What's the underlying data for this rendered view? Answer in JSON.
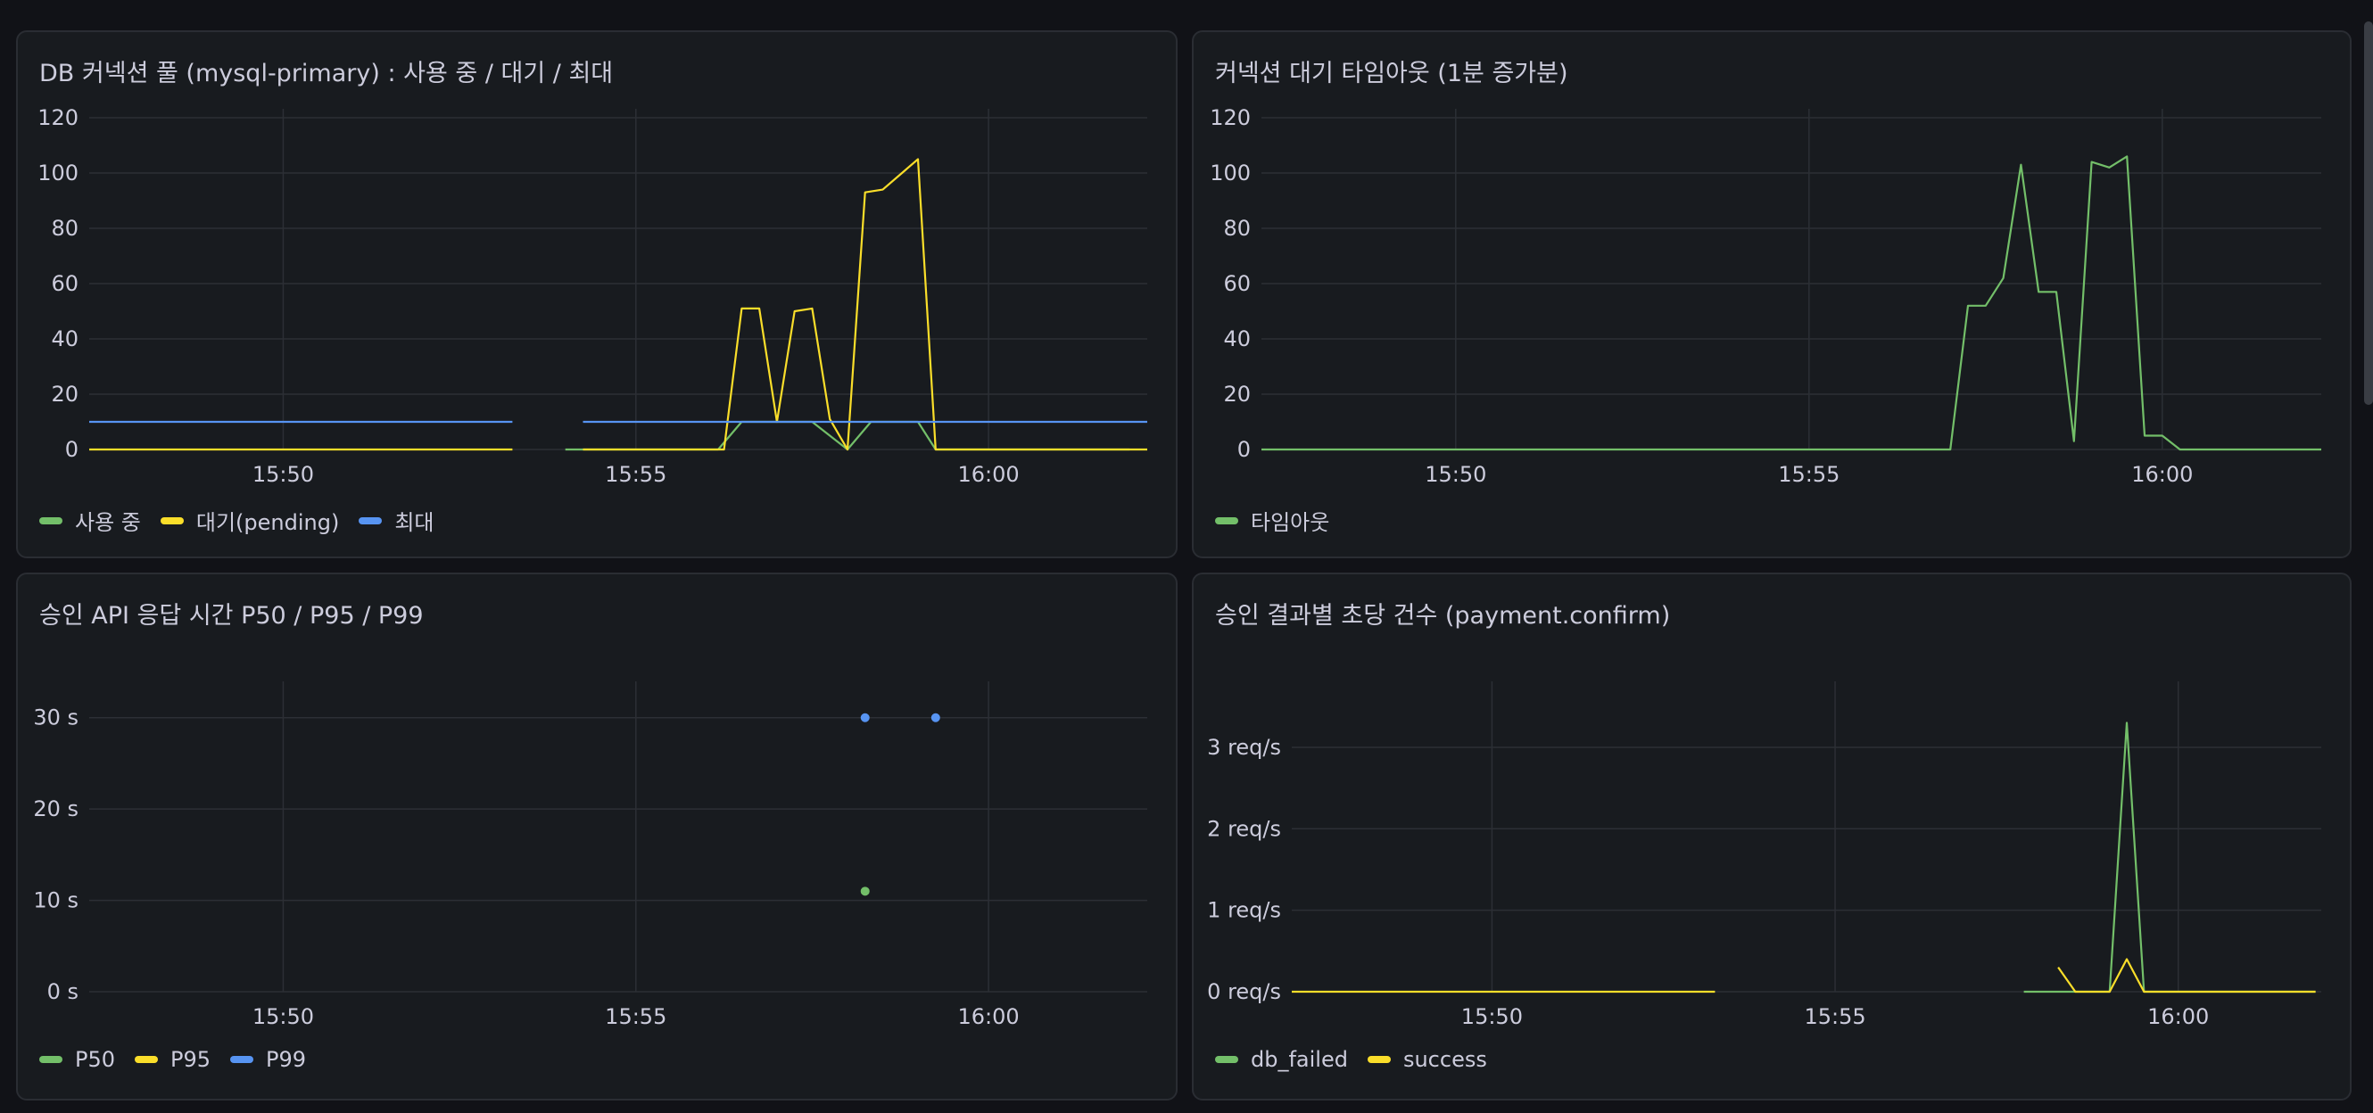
{
  "colors": {
    "green": "#73bf69",
    "yellow": "#fade2a",
    "blue": "#5794f2",
    "grid": "#2c2f35"
  },
  "panels": [
    {
      "title": "DB 커넥션 풀 (mysql-primary) : 사용 중 / 대기 / 최대",
      "legend": [
        {
          "label": "사용 중",
          "color": "#73bf69"
        },
        {
          "label": "대기(pending)",
          "color": "#fade2a"
        },
        {
          "label": "최대",
          "color": "#5794f2"
        }
      ]
    },
    {
      "title": "커넥션 대기 타임아웃 (1분 증가분)",
      "legend": [
        {
          "label": "타임아웃",
          "color": "#73bf69"
        }
      ]
    },
    {
      "title": "승인 API 응답 시간 P50 / P95 / P99",
      "legend": [
        {
          "label": "P50",
          "color": "#73bf69"
        },
        {
          "label": "P95",
          "color": "#fade2a"
        },
        {
          "label": "P99",
          "color": "#5794f2"
        }
      ]
    },
    {
      "title": "승인 결과별 초당 건수 (payment.confirm)",
      "legend": [
        {
          "label": "db_failed",
          "color": "#73bf69"
        },
        {
          "label": "success",
          "color": "#fade2a"
        }
      ]
    }
  ],
  "chart_data": [
    {
      "type": "line",
      "title": "DB 커넥션 풀 (mysql-primary) : 사용 중 / 대기 / 최대",
      "x_unit": "time (HH:MM)",
      "x_ticks": [
        "15:50",
        "15:55",
        "16:00"
      ],
      "xlim": [
        "15:47:15",
        "16:02:15"
      ],
      "y_ticks": [
        "0",
        "20",
        "40",
        "60",
        "80",
        "100",
        "120"
      ],
      "ylim": [
        0,
        120
      ],
      "series": [
        {
          "name": "사용 중",
          "color": "#73bf69",
          "segments": [
            [
              [
                "15:54:00",
                0
              ],
              [
                "15:56:10",
                0
              ],
              [
                "15:56:30",
                10
              ],
              [
                "15:57:00",
                10
              ],
              [
                "15:57:30",
                10
              ],
              [
                "15:58:00",
                0
              ],
              [
                "15:58:20",
                10
              ],
              [
                "15:59:00",
                10
              ],
              [
                "15:59:15",
                0
              ],
              [
                "16:02:00",
                0
              ]
            ]
          ]
        },
        {
          "name": "대기(pending)",
          "color": "#fade2a",
          "segments": [
            [
              [
                "15:47:15",
                0
              ],
              [
                "15:53:15",
                0
              ]
            ],
            [
              [
                "15:54:15",
                0
              ],
              [
                "15:56:15",
                0
              ],
              [
                "15:56:30",
                51
              ],
              [
                "15:56:45",
                51
              ],
              [
                "15:57:00",
                10
              ],
              [
                "15:57:15",
                50
              ],
              [
                "15:57:30",
                51
              ],
              [
                "15:57:45",
                11
              ],
              [
                "15:58:00",
                0
              ],
              [
                "15:58:15",
                93
              ],
              [
                "15:58:30",
                94
              ],
              [
                "15:59:00",
                105
              ],
              [
                "15:59:15",
                0
              ],
              [
                "16:02:15",
                0
              ]
            ]
          ]
        },
        {
          "name": "최대",
          "color": "#5794f2",
          "segments": [
            [
              [
                "15:47:15",
                10
              ],
              [
                "15:53:15",
                10
              ]
            ],
            [
              [
                "15:54:15",
                10
              ],
              [
                "16:02:15",
                10
              ]
            ]
          ]
        }
      ]
    },
    {
      "type": "line",
      "title": "커넥션 대기 타임아웃 (1분 증가분)",
      "x_ticks": [
        "15:50",
        "15:55",
        "16:00"
      ],
      "xlim": [
        "15:47:15",
        "16:02:15"
      ],
      "y_ticks": [
        "0",
        "20",
        "40",
        "60",
        "80",
        "100",
        "120"
      ],
      "ylim": [
        0,
        120
      ],
      "series": [
        {
          "name": "타임아웃",
          "color": "#73bf69",
          "segments": [
            [
              [
                "15:47:15",
                0
              ],
              [
                "15:57:00",
                0
              ],
              [
                "15:57:15",
                52
              ],
              [
                "15:57:30",
                52
              ],
              [
                "15:57:45",
                62
              ],
              [
                "15:58:00",
                103
              ],
              [
                "15:58:15",
                57
              ],
              [
                "15:58:30",
                57
              ],
              [
                "15:58:45",
                3
              ],
              [
                "15:59:00",
                104
              ],
              [
                "15:59:15",
                102
              ],
              [
                "15:59:30",
                106
              ],
              [
                "15:59:45",
                5
              ],
              [
                "16:00:00",
                5
              ],
              [
                "16:00:15",
                0
              ],
              [
                "16:02:15",
                0
              ]
            ]
          ]
        }
      ]
    },
    {
      "type": "scatter",
      "title": "승인 API 응답 시간 P50 / P95 / P99",
      "x_ticks": [
        "15:50",
        "15:55",
        "16:00"
      ],
      "xlim": [
        "15:47:15",
        "16:02:15"
      ],
      "y_ticks": [
        "0 s",
        "10 s",
        "20 s",
        "30 s"
      ],
      "ylim": [
        0,
        33
      ],
      "series": [
        {
          "name": "P50",
          "color": "#73bf69",
          "points": [
            [
              "15:58:15",
              11
            ]
          ]
        },
        {
          "name": "P95",
          "color": "#fade2a",
          "points": []
        },
        {
          "name": "P99",
          "color": "#5794f2",
          "points": [
            [
              "15:58:15",
              30
            ],
            [
              "15:59:15",
              30
            ]
          ]
        }
      ]
    },
    {
      "type": "line",
      "title": "승인 결과별 초당 건수 (payment.confirm)",
      "x_ticks": [
        "15:50",
        "15:55",
        "16:00"
      ],
      "xlim": [
        "15:47:05",
        "16:02:05"
      ],
      "y_ticks": [
        "0 req/s",
        "1 req/s",
        "2 req/s",
        "3 req/s"
      ],
      "ylim": [
        0,
        3.7
      ],
      "series": [
        {
          "name": "db_failed",
          "color": "#73bf69",
          "segments": [
            [
              [
                "15:57:45",
                0
              ],
              [
                "15:58:30",
                0
              ],
              [
                "15:59:00",
                0
              ],
              [
                "15:59:15",
                3.3
              ],
              [
                "15:59:30",
                0
              ],
              [
                "16:02:00",
                0
              ]
            ]
          ]
        },
        {
          "name": "success",
          "color": "#fade2a",
          "segments": [
            [
              [
                "15:47:05",
                0
              ],
              [
                "15:53:15",
                0
              ]
            ],
            [
              [
                "15:58:15",
                0.3
              ],
              [
                "15:58:30",
                0
              ],
              [
                "15:59:00",
                0
              ],
              [
                "15:59:15",
                0.4
              ],
              [
                "15:59:30",
                0
              ],
              [
                "16:02:00",
                0
              ]
            ]
          ]
        }
      ]
    }
  ]
}
